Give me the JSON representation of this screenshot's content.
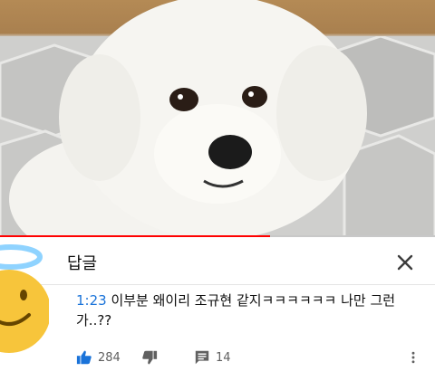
{
  "reply_panel": {
    "title": "답글",
    "close_icon": "close-icon"
  },
  "comment": {
    "timestamp": "1:23",
    "text": " 이부분 왜이리 조규현 같지ㅋㅋㅋㅋㅋㅋ 나만 그런가..??",
    "like_count": "284",
    "reply_count": "14"
  },
  "icons": {
    "like": "thumbs-up-icon",
    "dislike": "thumbs-down-icon",
    "reply": "comment-icon",
    "more": "more-vertical-icon",
    "avatar": "angel-smiley-icon"
  },
  "player": {
    "progress": 0.62
  },
  "colors": {
    "accent": "#1a73d9",
    "progress": "#ff0000"
  }
}
